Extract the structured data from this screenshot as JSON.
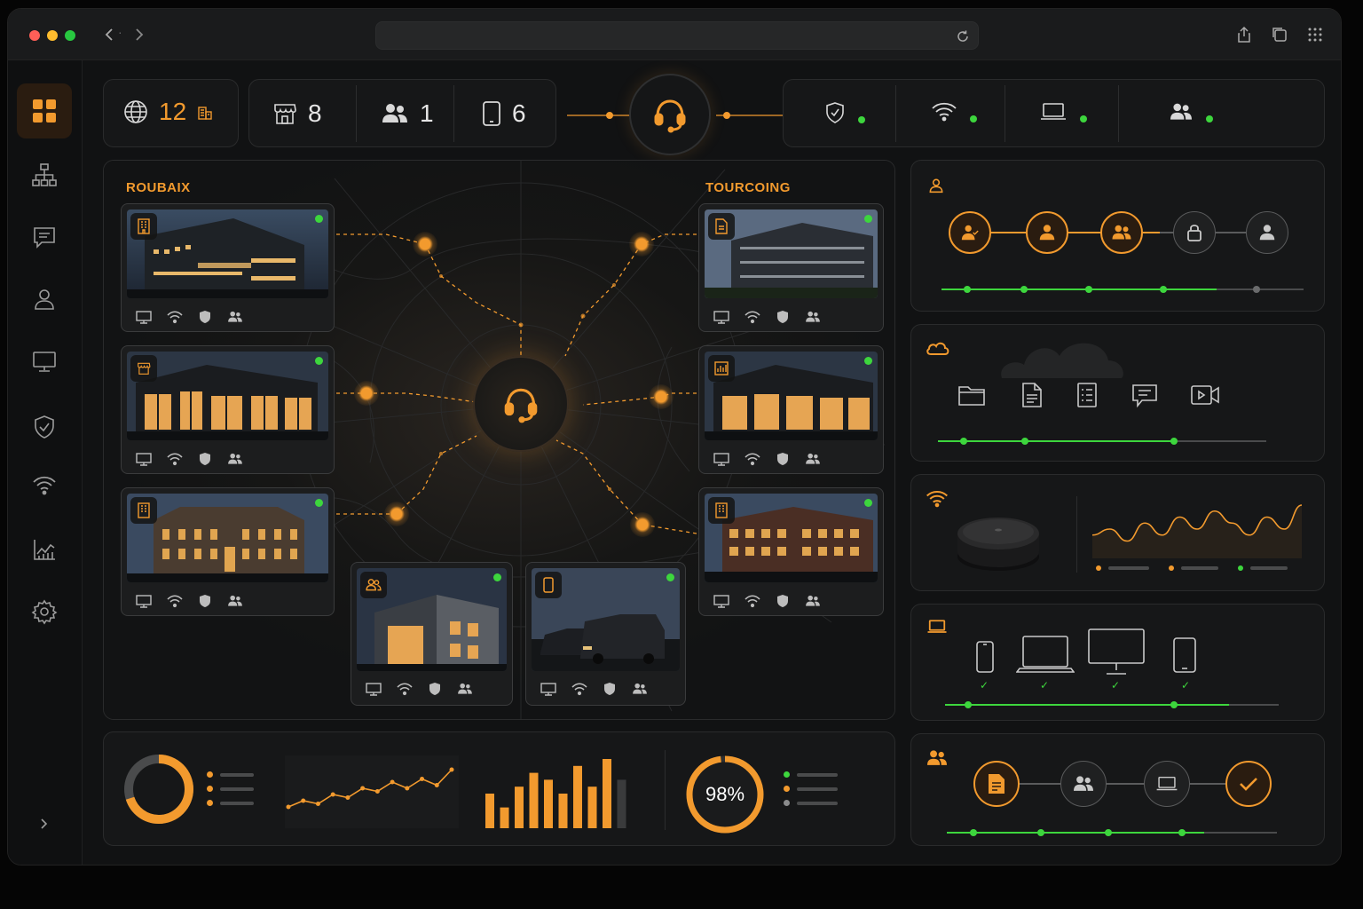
{
  "colors": {
    "accent": "#f29a2e",
    "ok": "#3dd63d",
    "bg": "#111213",
    "panel": "#161718"
  },
  "topbar": {
    "sites": {
      "value": "12",
      "icon": "globe-icon"
    },
    "stores": {
      "value": "8",
      "icon": "storefront-icon"
    },
    "users": {
      "value": "1",
      "icon": "users-icon"
    },
    "devices": {
      "value": "6",
      "icon": "tablet-icon"
    },
    "status": [
      {
        "name": "security",
        "icon": "shield-check-icon",
        "state": "ok"
      },
      {
        "name": "wifi",
        "icon": "wifi-icon",
        "state": "ok"
      },
      {
        "name": "laptop",
        "icon": "laptop-icon",
        "state": "ok"
      },
      {
        "name": "users",
        "icon": "users-icon",
        "state": "ok"
      }
    ]
  },
  "sidebar": {
    "items": [
      {
        "name": "dashboard",
        "icon": "grid-icon",
        "active": true
      },
      {
        "name": "network",
        "icon": "org-chart-icon"
      },
      {
        "name": "messages",
        "icon": "chat-icon"
      },
      {
        "name": "user",
        "icon": "user-icon"
      },
      {
        "name": "monitor",
        "icon": "monitor-icon"
      },
      {
        "name": "security",
        "icon": "shield-icon"
      },
      {
        "name": "wifi",
        "icon": "wifi-icon"
      },
      {
        "name": "analytics",
        "icon": "chart-icon"
      },
      {
        "name": "settings",
        "icon": "gear-icon"
      }
    ]
  },
  "map": {
    "left_city": "ROUBAIX",
    "right_city": "TOURCOING",
    "sites": [
      {
        "icon": "office-icon",
        "status": "online",
        "type": "office building"
      },
      {
        "icon": "store-icon",
        "status": "online",
        "type": "retail store"
      },
      {
        "icon": "office-icon",
        "status": "online",
        "type": "historic building"
      },
      {
        "icon": "file-icon",
        "status": "online",
        "type": "office building"
      },
      {
        "icon": "chart-icon",
        "status": "online",
        "type": "retail store"
      },
      {
        "icon": "office-icon",
        "status": "online",
        "type": "brick building"
      },
      {
        "icon": "users-icon",
        "status": "online",
        "type": "modern building"
      },
      {
        "icon": "phone-icon",
        "status": "online",
        "type": "vans"
      }
    ]
  },
  "bottom": {
    "donut_fraction": 0.7,
    "line_values": [
      2,
      3,
      2.5,
      4,
      3.5,
      5,
      4.5,
      6,
      5,
      6.5,
      5.5,
      8
    ],
    "bar_values": [
      5,
      3,
      6,
      8,
      7,
      5,
      9,
      6,
      10,
      7
    ],
    "percent_label": "98%",
    "percent_value": 98
  },
  "right": {
    "workflow_steps": [
      "user-check-icon",
      "user-icon",
      "users-icon",
      "lock-icon",
      "user-icon"
    ],
    "files": [
      "folder-icon",
      "document-icon",
      "list-icon",
      "chat-icon",
      "video-icon"
    ],
    "wifi_wave": [
      3,
      4,
      2,
      5,
      3,
      6,
      4,
      7,
      5,
      3,
      6,
      4,
      8
    ],
    "devices": [
      "phone-icon",
      "laptop-icon",
      "monitor-icon",
      "tablet-icon"
    ],
    "process": [
      "document-icon",
      "users-icon",
      "laptop-icon",
      "check-icon"
    ]
  }
}
